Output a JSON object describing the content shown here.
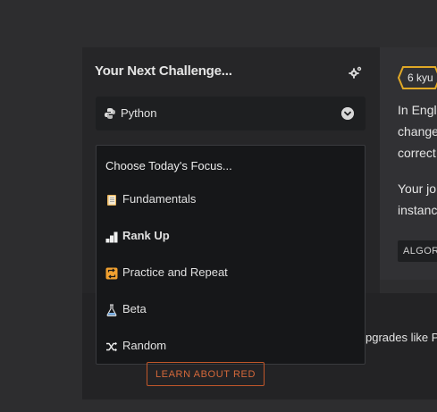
{
  "challenge": {
    "title": "Your Next Challenge...",
    "language": "Python"
  },
  "focus_menu": {
    "heading": "Choose Today's Focus...",
    "items": [
      {
        "label": "Fundamentals",
        "icon": "notebook-icon",
        "bold": false
      },
      {
        "label": "Rank Up",
        "icon": "bar-chart-icon",
        "bold": true
      },
      {
        "label": "Practice and Repeat",
        "icon": "repeat-icon",
        "bold": false
      },
      {
        "label": "Beta",
        "icon": "flask-icon",
        "bold": false
      },
      {
        "label": "Random",
        "icon": "shuffle-icon",
        "bold": false
      }
    ]
  },
  "kata": {
    "rank": "6 kyu",
    "description_lines": [
      "In Engl",
      "change",
      "correct"
    ],
    "description_lines2": [
      "Your jo",
      "instanc"
    ],
    "tag": "ALGOR"
  },
  "promo": {
    "text": "pgrades like P",
    "button_label": "LEARN ABOUT RED"
  },
  "colors": {
    "accent_orange": "#c0572a",
    "kyu_yellow": "#e0a826"
  }
}
